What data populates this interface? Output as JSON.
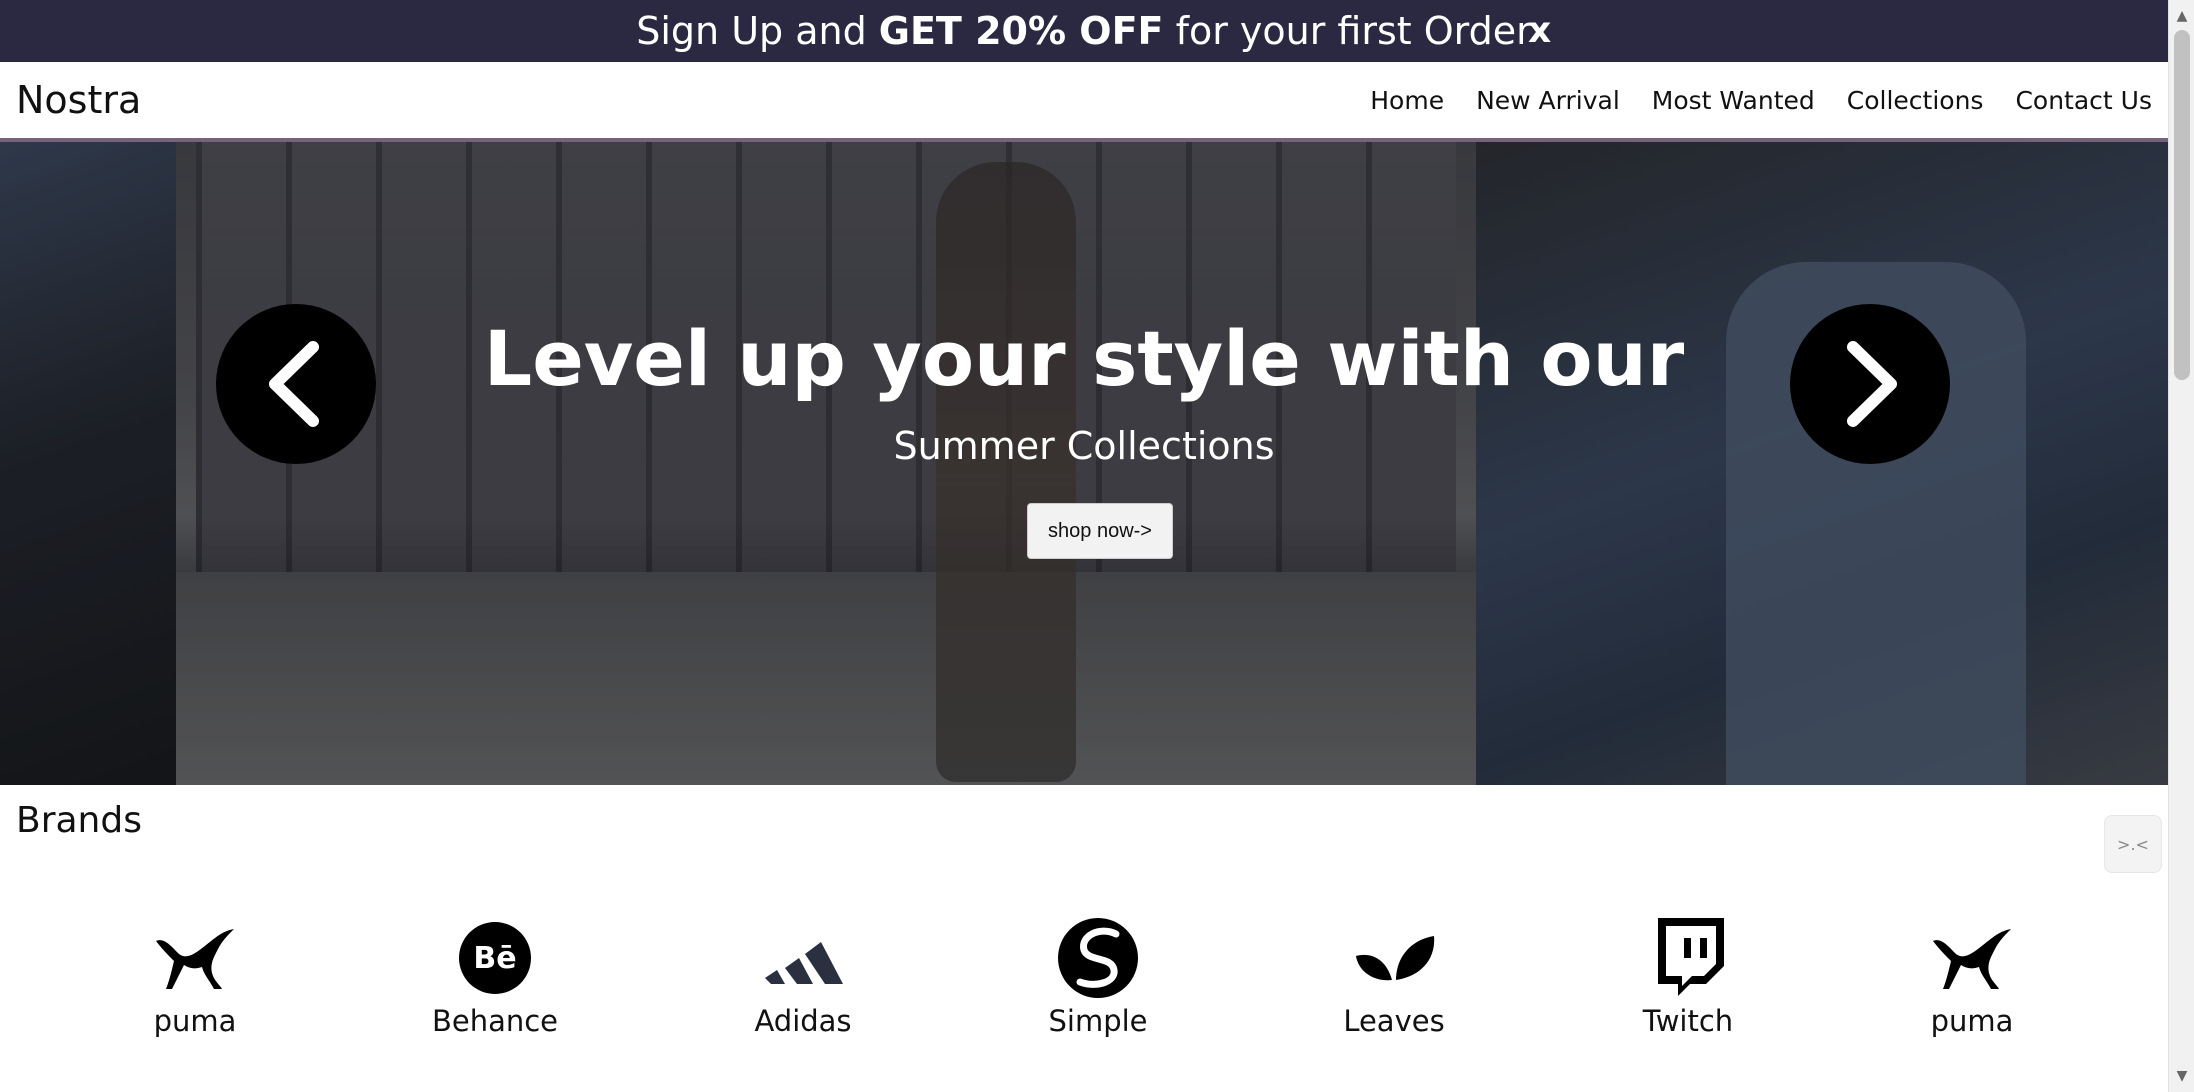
{
  "promo": {
    "text_before": "Sign Up and ",
    "text_bold": "GET 20% OFF",
    "text_after": " for your first Order",
    "close_label": "x"
  },
  "nav": {
    "brand": "Nostra",
    "links": [
      "Home",
      "New Arrival",
      "Most Wanted",
      "Collections",
      "Contact Us"
    ]
  },
  "hero": {
    "title": "Level up your style with our",
    "subtitle": "Summer Collections",
    "cta_label": "shop now->",
    "prev_icon": "chevron-left-icon",
    "next_icon": "chevron-right-icon"
  },
  "brands": {
    "title": "Brands",
    "items": [
      {
        "name": "puma",
        "icon": "puma-icon"
      },
      {
        "name": "Behance",
        "icon": "behance-icon"
      },
      {
        "name": "Adidas",
        "icon": "adidas-icon"
      },
      {
        "name": "Simple",
        "icon": "simple-icon"
      },
      {
        "name": "Leaves",
        "icon": "leaves-icon"
      },
      {
        "name": "Twitch",
        "icon": "twitch-icon"
      },
      {
        "name": "puma",
        "icon": "puma-icon"
      }
    ]
  },
  "widget": {
    "label": ">.<"
  },
  "colors": {
    "promo_bg": "#2a2941",
    "nav_accent": "#74637b",
    "button_bg": "#000000"
  }
}
